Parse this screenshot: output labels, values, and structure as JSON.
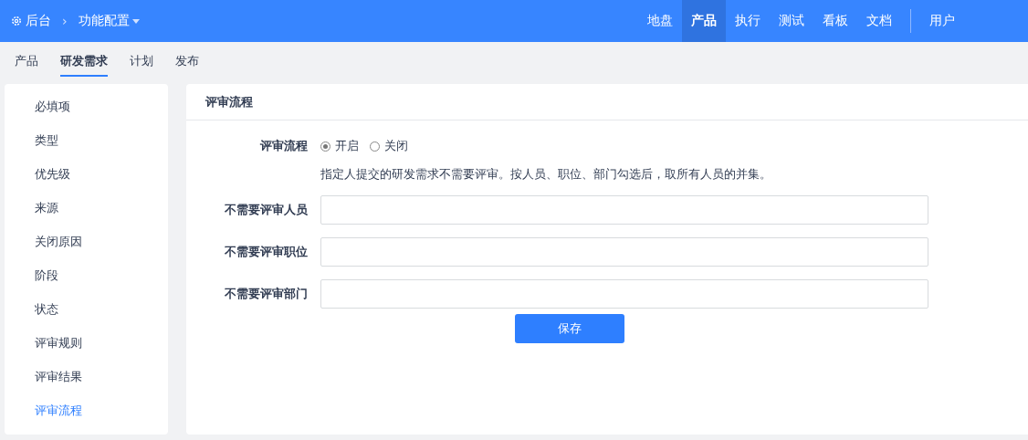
{
  "breadcrumb": {
    "home": "后台",
    "separator": "›",
    "current": "功能配置"
  },
  "nav": [
    {
      "label": "地盘",
      "selected": false
    },
    {
      "label": "产品",
      "selected": true
    },
    {
      "label": "执行",
      "selected": false
    },
    {
      "label": "测试",
      "selected": false
    },
    {
      "label": "看板",
      "selected": false
    },
    {
      "label": "文档",
      "selected": false
    }
  ],
  "user": "用户",
  "subtabs": [
    {
      "label": "产品",
      "selected": false
    },
    {
      "label": "研发需求",
      "selected": true
    },
    {
      "label": "计划",
      "selected": false
    },
    {
      "label": "发布",
      "selected": false
    }
  ],
  "sidebar": {
    "items": [
      {
        "label": "必填项",
        "selected": false
      },
      {
        "label": "类型",
        "selected": false
      },
      {
        "label": "优先级",
        "selected": false
      },
      {
        "label": "来源",
        "selected": false
      },
      {
        "label": "关闭原因",
        "selected": false
      },
      {
        "label": "阶段",
        "selected": false
      },
      {
        "label": "状态",
        "selected": false
      },
      {
        "label": "评审规则",
        "selected": false
      },
      {
        "label": "评审结果",
        "selected": false
      },
      {
        "label": "评审流程",
        "selected": true
      }
    ]
  },
  "panel": {
    "title": "评审流程",
    "radio_label": "评审流程",
    "options": [
      {
        "label": "开启",
        "selected": true
      },
      {
        "label": "关闭",
        "selected": false
      }
    ],
    "hint": "指定人提交的研发需求不需要评审。按人员、职位、部门勾选后，取所有人员的并集。",
    "fields": [
      {
        "label": "不需要评审人员"
      },
      {
        "label": "不需要评审职位"
      },
      {
        "label": "不需要评审部门"
      }
    ],
    "save": "保存"
  }
}
